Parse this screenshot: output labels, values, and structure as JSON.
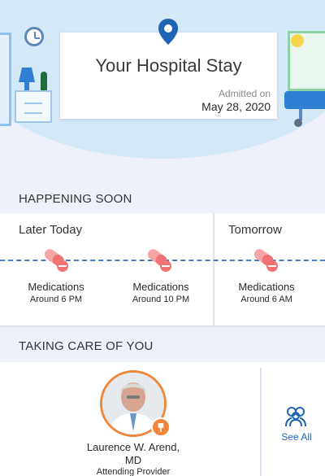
{
  "stay": {
    "title": "Your Hospital Stay",
    "admitted_label": "Admitted on",
    "admitted_date": "May 28, 2020"
  },
  "happening_soon": {
    "title": "HAPPENING SOON",
    "columns": [
      {
        "label": "Later Today"
      },
      {
        "label": "Tomorrow"
      }
    ],
    "items": [
      {
        "label": "Medications",
        "time": "Around 6 PM"
      },
      {
        "label": "Medications",
        "time": "Around 10 PM"
      },
      {
        "label": "Medications",
        "time": "Around 6 AM"
      }
    ]
  },
  "care": {
    "title": "TAKING CARE OF YOU",
    "provider": {
      "name": "Laurence W. Arend, MD",
      "role": "Attending Provider"
    },
    "see_all": "See All"
  },
  "colors": {
    "accent": "#f0863a",
    "link": "#1f63b5",
    "pill": "#f07272"
  }
}
